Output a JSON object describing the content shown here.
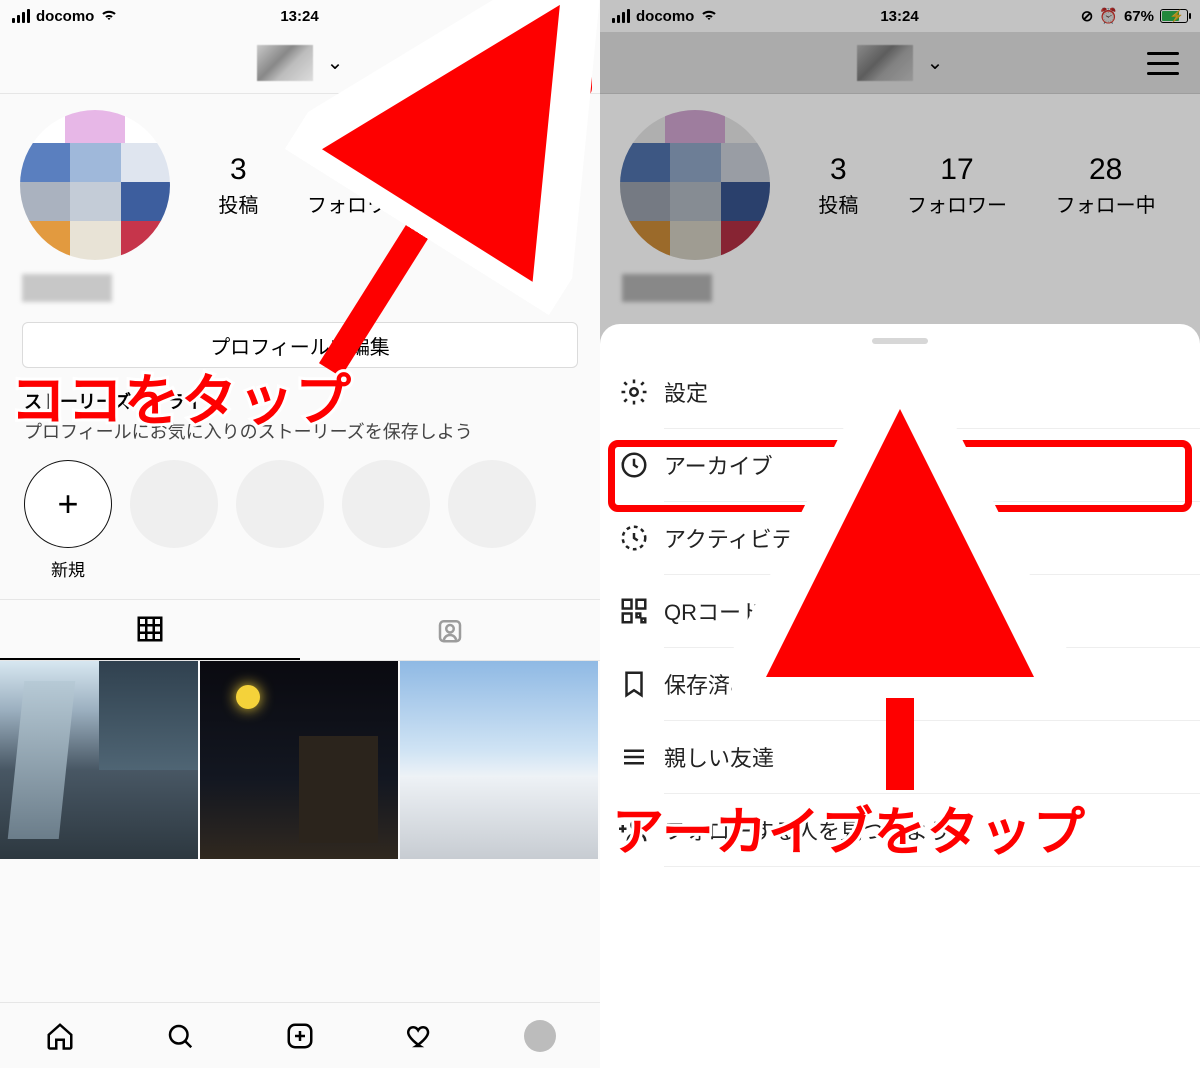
{
  "status": {
    "carrier": "docomo",
    "time": "13:24",
    "battery_pct": "67%"
  },
  "profile": {
    "posts_num": "3",
    "posts_lbl": "投稿",
    "followers_num": "17",
    "followers_lbl": "フォロワー",
    "following_num": "28",
    "following_lbl": "フォロー中",
    "edit_profile_label": "プロフィールを編集",
    "highlights_heading": "ストーリーズハイライト",
    "highlights_sub": "プロフィールにお気に入りのストーリーズを保存しよう",
    "new_label": "新規"
  },
  "menu": {
    "settings": "設定",
    "archive": "アーカイブ",
    "activity": "アクティビティ",
    "qr": "QRコード",
    "saved": "保存済み",
    "close_friends": "親しい友達",
    "discover": "フォローする人を見つけよう"
  },
  "annotations": {
    "tap_here": "ココをタップ",
    "tap_archive": "アーカイブをタップ"
  },
  "colors": {
    "accent": "#fe0000"
  }
}
